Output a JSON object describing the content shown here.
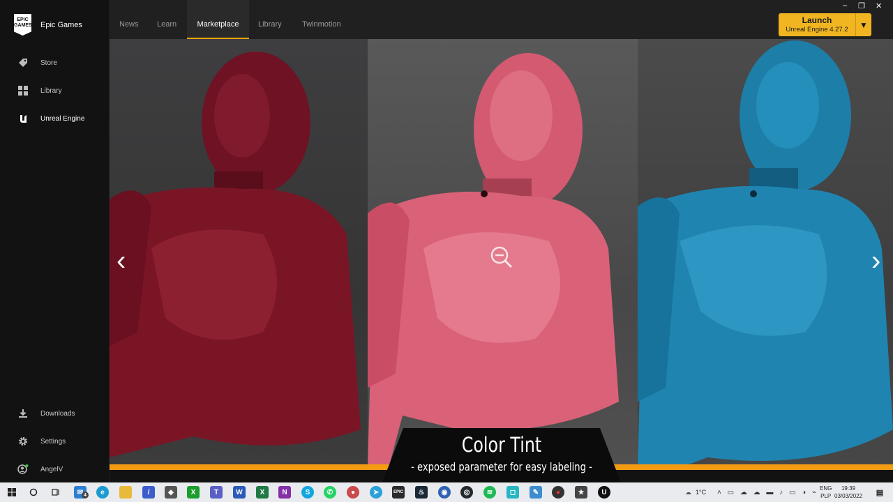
{
  "brand": {
    "logo_text": "EPIC GAMES",
    "name": "Epic Games"
  },
  "sidebar": {
    "items": [
      {
        "label": "Store",
        "icon": "tag-icon"
      },
      {
        "label": "Library",
        "icon": "grid-icon"
      },
      {
        "label": "Unreal Engine",
        "icon": "unreal-icon"
      }
    ],
    "bottom": [
      {
        "label": "Downloads",
        "icon": "download-icon"
      },
      {
        "label": "Settings",
        "icon": "gear-icon"
      },
      {
        "label": "AngelV",
        "icon": "user-icon"
      }
    ]
  },
  "tabs": [
    {
      "label": "News"
    },
    {
      "label": "Learn"
    },
    {
      "label": "Marketplace",
      "active": true
    },
    {
      "label": "Library"
    },
    {
      "label": "Twinmotion"
    }
  ],
  "launch": {
    "title": "Launch",
    "subtitle": "Unreal Engine 4.27.2",
    "caret": "▼"
  },
  "window_controls": {
    "minimize": "–",
    "maximize": "❐",
    "close": "✕"
  },
  "media": {
    "prev": "‹",
    "next": "›",
    "caption_title": "Color Tint",
    "caption_subtitle": "- exposed parameter for easy labeling -"
  },
  "colors": {
    "accent": "#f0b520",
    "orange_bar": "#f39c12",
    "mannequin_red": "#7a1526",
    "mannequin_pink": "#d96278",
    "mannequin_blue": "#1f84b0"
  },
  "taskbar": {
    "weather": "1°C",
    "lang": "ENG",
    "layout": "PLP",
    "time": "19:39",
    "date": "03/03/2022",
    "mail_badge": "4"
  }
}
